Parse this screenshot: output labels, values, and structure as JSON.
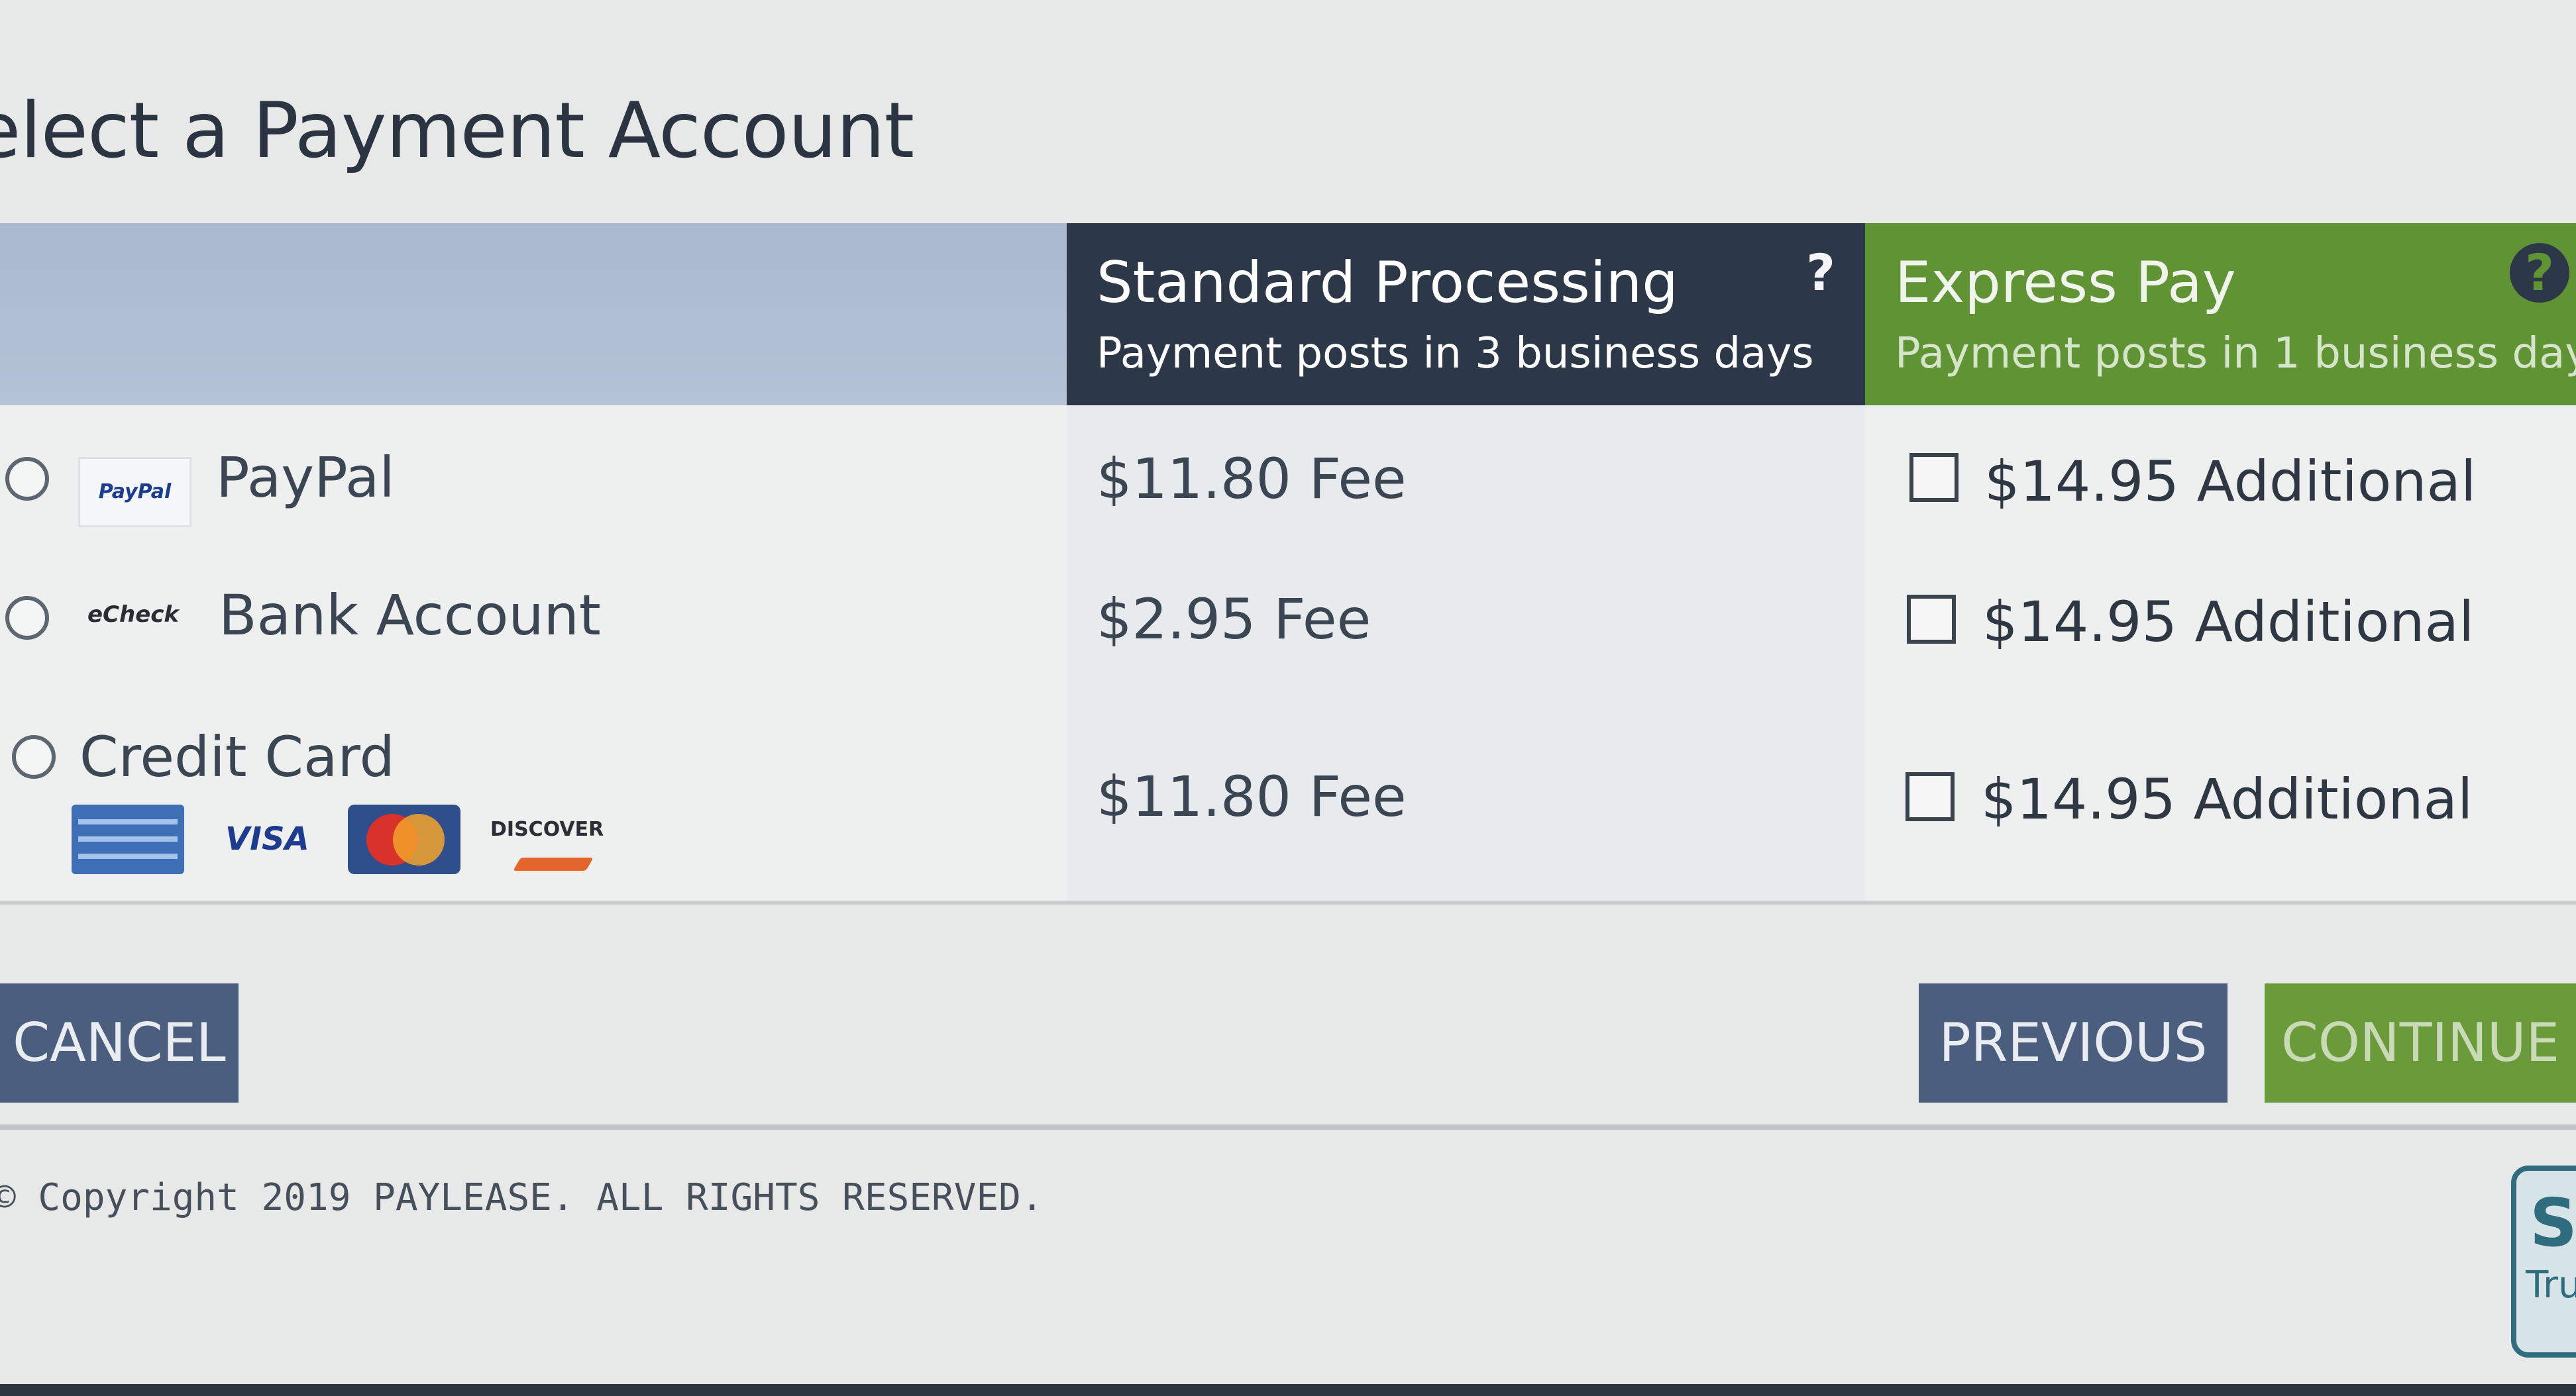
{
  "page": {
    "title": "elect a Payment Account"
  },
  "columns": {
    "standard": {
      "title": "Standard Processing",
      "subtitle": "Payment posts in 3 business days",
      "help": "?"
    },
    "express": {
      "title": "Express Pay",
      "subtitle": "Payment posts in 1 business day",
      "help": "?"
    }
  },
  "rows": [
    {
      "label": "PayPal",
      "logo": "PayPal",
      "standard_fee": "$11.80 Fee",
      "express_fee": "$14.95 Additional"
    },
    {
      "label": "Bank Account",
      "logo": "eCheck",
      "standard_fee": "$2.95 Fee",
      "express_fee": "$14.95 Additional"
    },
    {
      "label": "Credit Card",
      "standard_fee": "$11.80 Fee",
      "express_fee": "$14.95 Additional",
      "card_logos": [
        "amex-icon",
        "VISA",
        "mastercard-icon",
        "DISCOVER"
      ]
    }
  ],
  "buttons": {
    "cancel": "CANCEL",
    "previous": "PREVIOUS",
    "continue": "CONTINUE"
  },
  "footer": {
    "copyright": "© Copyright 2019 PAYLEASE. ALL RIGHTS RESERVED."
  },
  "trust_badge": {
    "letter": "S",
    "text": "Tru"
  },
  "colors": {
    "standard_header": "#2c3747",
    "express_header": "#5f9334",
    "button_blue": "#4b5e7d",
    "button_green": "#6a9a3a"
  }
}
